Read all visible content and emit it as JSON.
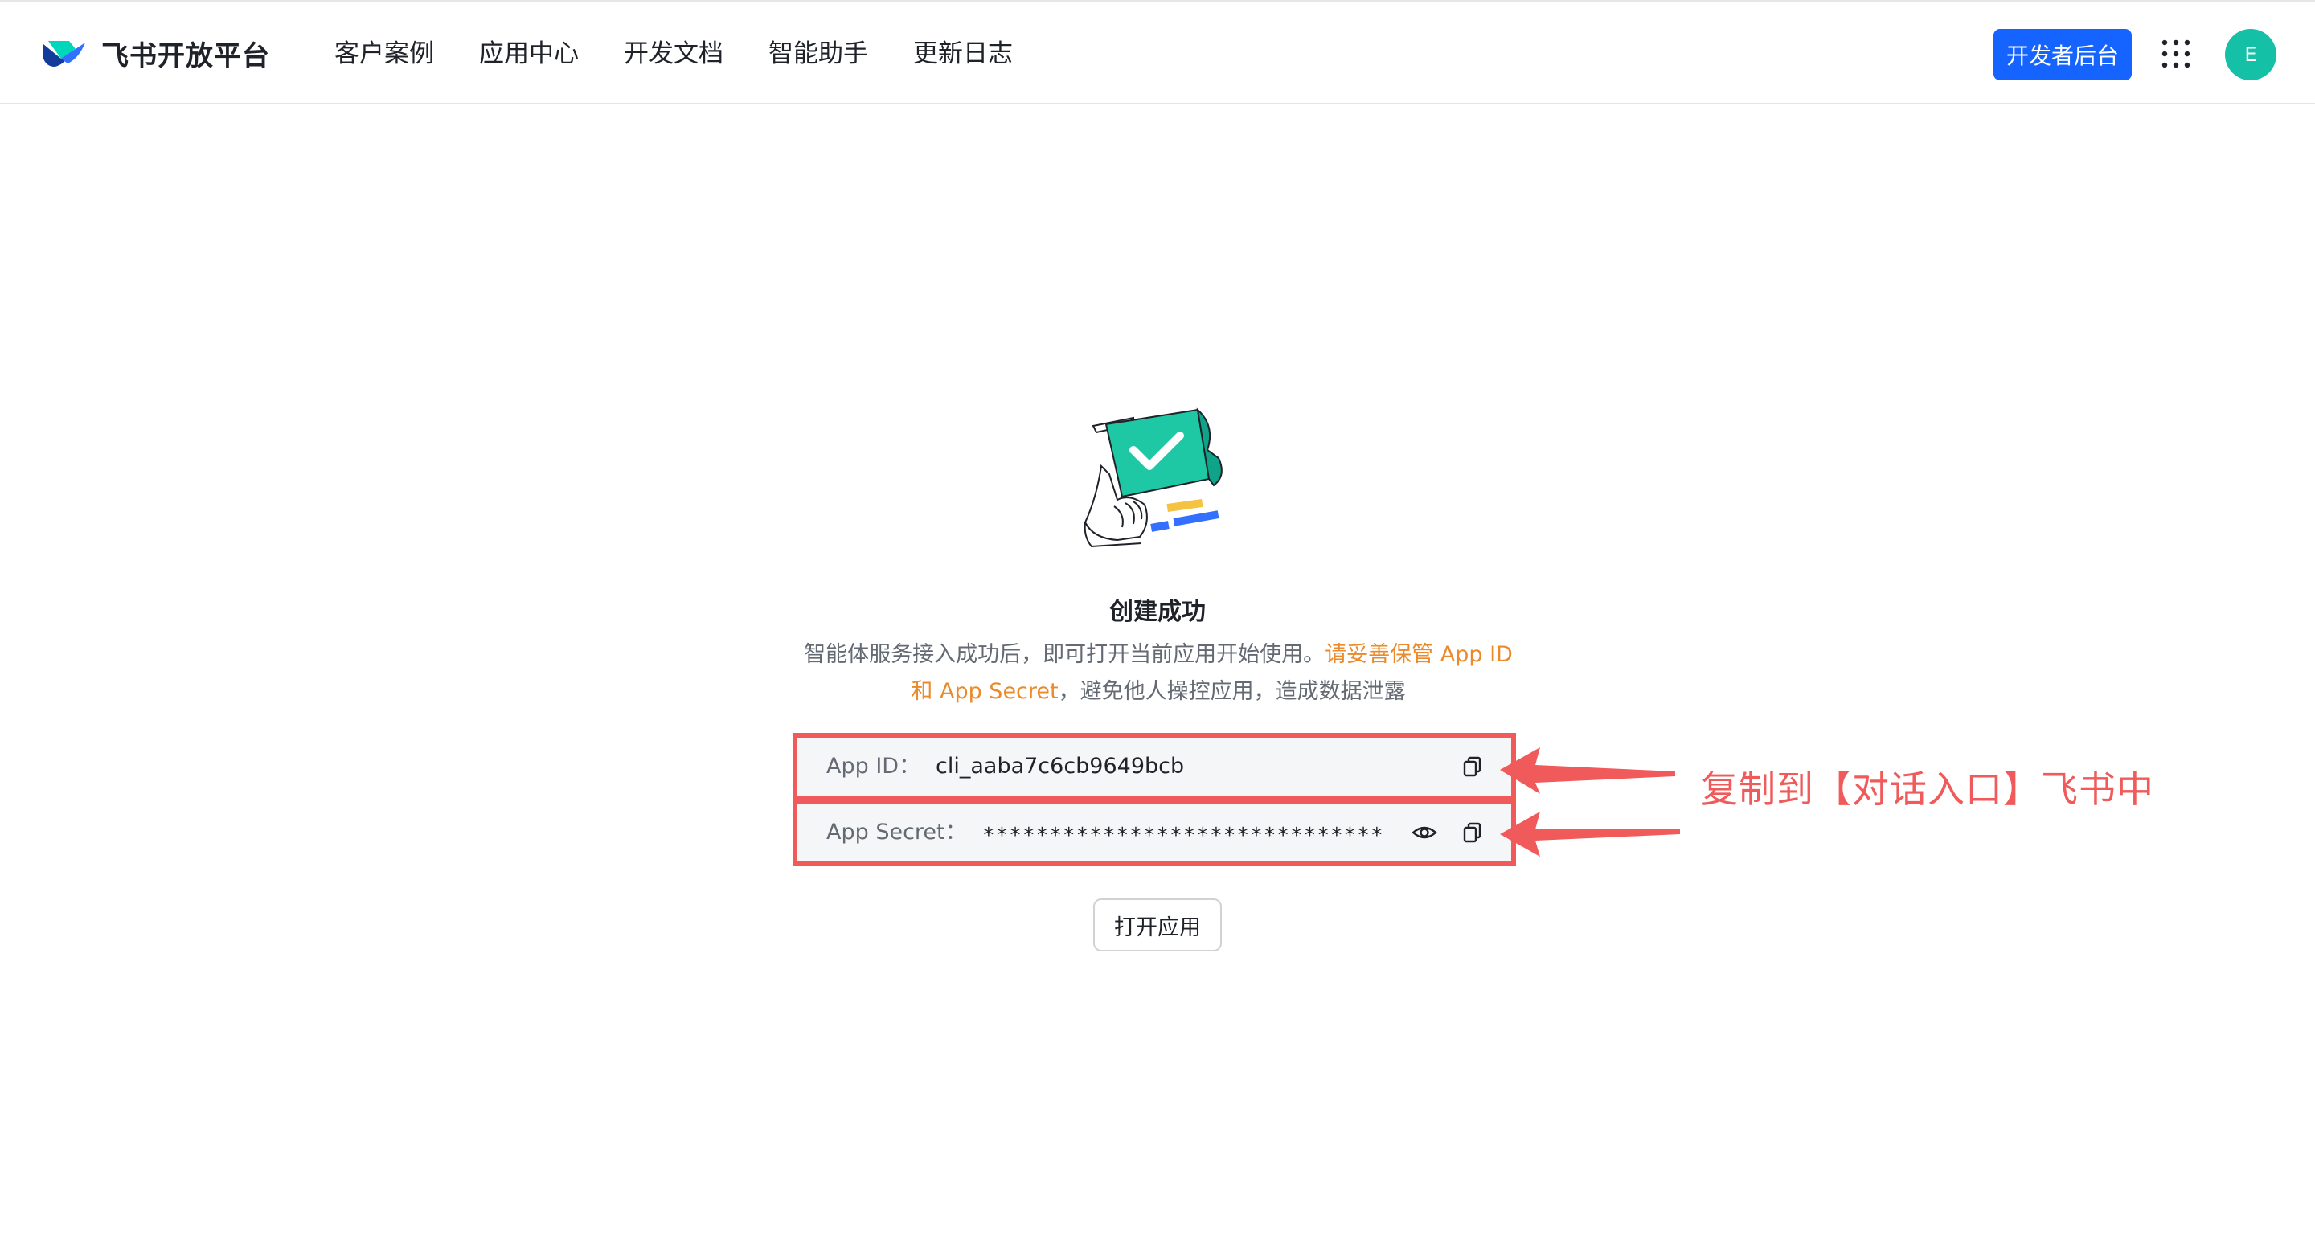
{
  "header": {
    "logo_text": "飞书开放平台",
    "nav": [
      "客户案例",
      "应用中心",
      "开发文档",
      "智能助手",
      "更新日志"
    ],
    "dev_button": "开发者后台",
    "avatar_initial": "E"
  },
  "main": {
    "title": "创建成功",
    "desc_normal": "智能体服务接入成功后，即可打开当前应用开始使用。",
    "desc_warn": "请妥善保管 App ID 和 App Secret",
    "desc_tail": "，避免他人操控应用，造成数据泄露",
    "app_id_label": "App ID：",
    "app_id_value": "cli_aaba7c6cb9649bcb",
    "app_secret_label": "App Secret：",
    "app_secret_value": "******************************",
    "open_button": "打开应用"
  },
  "annotation": {
    "text": "复制到【对话入口】飞书中"
  },
  "colors": {
    "primary": "#1664ff",
    "avatar": "#14c0a6",
    "warning": "#ea8a2a",
    "annotation_red": "#f05a5a"
  }
}
